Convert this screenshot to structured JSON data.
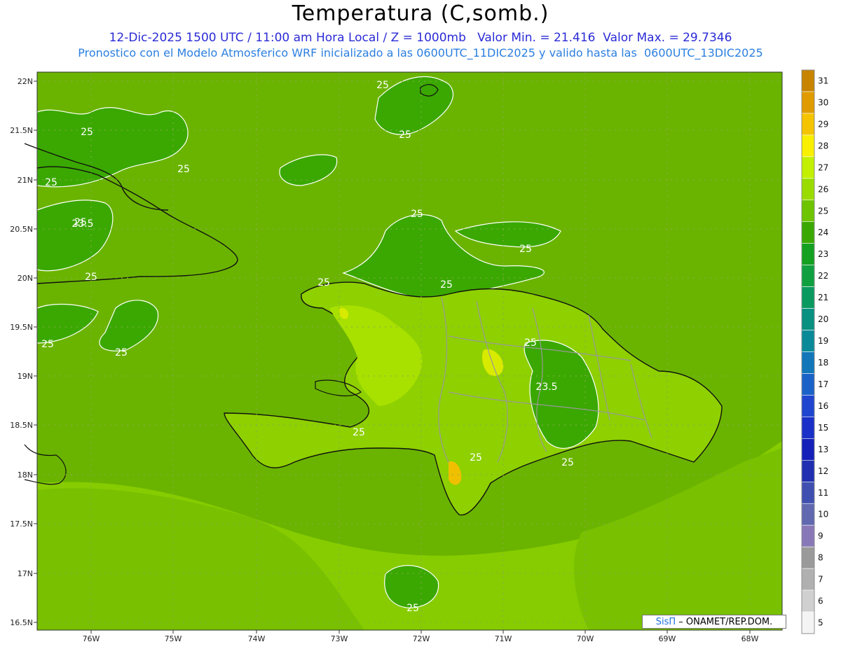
{
  "title": "Temperatura (C,somb.)",
  "subtitle_line1": "12-Dic-2025 1500 UTC / 11:00 am Hora Local / Z = 1000mb   Valor Min. = 21.416  Valor Max. = 29.7346",
  "subtitle_line2": "Pronostico con el Modelo Atmosferico WRF inicializado a las 0600UTC_11DIC2025 y valido hasta las  0600UTC_13DIC2025",
  "credit": {
    "brand": "SisΠ",
    "org": " –  ONAMET/REP.DOM."
  },
  "lat_labels": [
    "22N",
    "21.5N",
    "21N",
    "20.5N",
    "20N",
    "19.5N",
    "19N",
    "18.5N",
    "18N",
    "17.5N",
    "17N",
    "16.5N"
  ],
  "lon_labels": [
    "76W",
    "75W",
    "74W",
    "73W",
    "72W",
    "71W",
    "70W",
    "69W",
    "68W"
  ],
  "colorbar": {
    "labels": [
      "31",
      "30",
      "29",
      "28",
      "27",
      "26",
      "25",
      "24",
      "23",
      "22",
      "21",
      "20",
      "19",
      "18",
      "17",
      "16",
      "15",
      "13",
      "12",
      "11",
      "10",
      "9",
      "8",
      "7",
      "6",
      "5"
    ],
    "colors": [
      "#c88400",
      "#e09b00",
      "#f5c400",
      "#f8f000",
      "#c2f000",
      "#9adc00",
      "#6ec400",
      "#3aa800",
      "#14a020",
      "#10a040",
      "#0a9a60",
      "#089080",
      "#0a8a98",
      "#1276b8",
      "#1a62c8",
      "#2046d0",
      "#1a30c8",
      "#1420b8",
      "#2030b0",
      "#4050b0",
      "#6068b0",
      "#8878b8",
      "#9a9a9a",
      "#b0b0b0",
      "#d0d0d0",
      "#f4f4f4"
    ]
  },
  "contour_labels": [
    "25",
    "25",
    "25",
    "25",
    "25",
    "23.5",
    "25",
    "25",
    "25",
    "25",
    "25",
    "25",
    "25",
    "25",
    "25",
    "23.5",
    "25",
    "25",
    "25",
    "25"
  ]
}
